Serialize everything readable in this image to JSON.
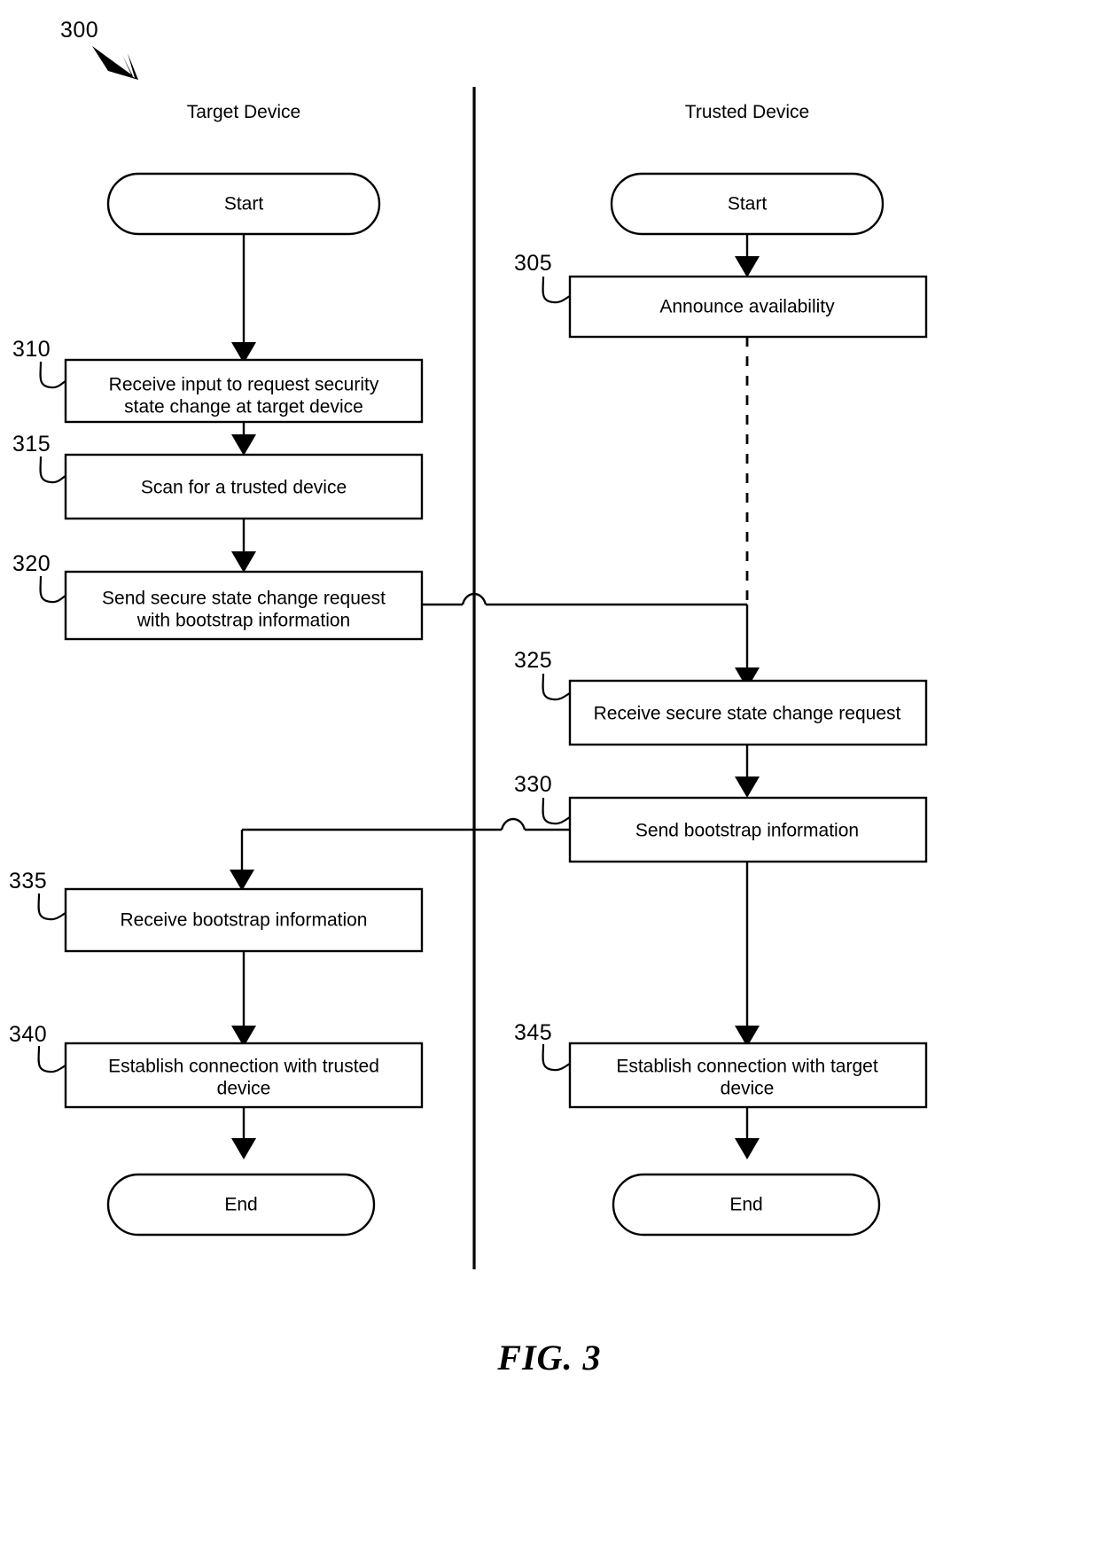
{
  "figure": {
    "number_ref": "300",
    "caption": "FIG. 3"
  },
  "lanes": [
    {
      "id": "target",
      "title": "Target Device"
    },
    {
      "id": "trusted",
      "title": "Trusted Device"
    }
  ],
  "nodes": {
    "target_start": {
      "label": "Start",
      "shape": "terminator",
      "ref": ""
    },
    "n310": {
      "label_line1": "Receive input to request security",
      "label_line2": "state change at target device",
      "shape": "process",
      "ref": "310"
    },
    "n315": {
      "label_line1": "Scan for a trusted device",
      "label_line2": "",
      "shape": "process",
      "ref": "315"
    },
    "n320": {
      "label_line1": "Send secure state change request",
      "label_line2": "with bootstrap information",
      "shape": "process",
      "ref": "320"
    },
    "n335": {
      "label_line1": "Receive bootstrap information",
      "label_line2": "",
      "shape": "process",
      "ref": "335"
    },
    "n340": {
      "label_line1": "Establish connection with trusted",
      "label_line2": "device",
      "shape": "process",
      "ref": "340"
    },
    "target_end": {
      "label": "End",
      "shape": "terminator",
      "ref": ""
    },
    "trusted_start": {
      "label": "Start",
      "shape": "terminator",
      "ref": ""
    },
    "n305": {
      "label_line1": "Announce availability",
      "label_line2": "",
      "shape": "process",
      "ref": "305"
    },
    "n325": {
      "label_line1": "Receive secure state change request",
      "label_line2": "",
      "shape": "process",
      "ref": "325"
    },
    "n330": {
      "label_line1": "Send bootstrap information",
      "label_line2": "",
      "shape": "process",
      "ref": "330"
    },
    "n345": {
      "label_line1": "Establish connection with target",
      "label_line2": "device",
      "shape": "process",
      "ref": "345"
    },
    "trusted_end": {
      "label": "End",
      "shape": "terminator",
      "ref": ""
    }
  },
  "colors": {
    "stroke": "#000000",
    "fill": "#ffffff",
    "background": "#ffffff"
  }
}
